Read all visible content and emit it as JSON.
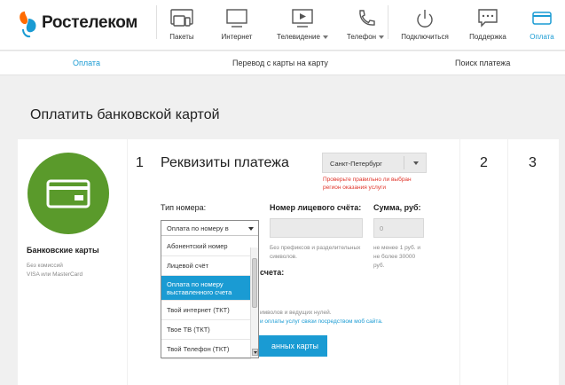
{
  "brand": {
    "name": "Ростелеком",
    "accent": "#1a9bd3",
    "orange": "#ff6b00"
  },
  "nav": {
    "items": [
      {
        "label": "Пакеты",
        "icon": "packages-icon"
      },
      {
        "label": "Интернет",
        "icon": "monitor-icon"
      },
      {
        "label": "Телевидение",
        "icon": "tv-icon"
      },
      {
        "label": "Телефон",
        "icon": "phone-icon"
      },
      {
        "label": "Подключиться",
        "icon": "power-icon"
      },
      {
        "label": "Поддержка",
        "icon": "chat-icon"
      },
      {
        "label": "Оплата",
        "icon": "card-icon"
      }
    ]
  },
  "subnav": {
    "payment": "Оплата",
    "card_transfer": "Перевод с карты на карту",
    "payment_search": "Поиск платежа"
  },
  "page": {
    "title": "Оплатить банковской картой"
  },
  "sidebar": {
    "title": "Банковские карты",
    "subtitle": "Без комиссий\nVISA или MasterCard",
    "icon": "bank-card-icon",
    "circle_color": "#5a9a2b"
  },
  "step1": {
    "number": "1",
    "title": "Реквизиты платежа",
    "region": "Санкт-Петербург",
    "region_warning": "Проверьте правильно ли выбран регион оказания услуги",
    "type_label": "Тип номера:",
    "type_value": "Оплата по номеру в",
    "account_label": "Номер лицевого счёта:",
    "account_hint": "Без префиксов и разделительных символов.",
    "sum_label": "Сумма, руб:",
    "sum_placeholder": "0",
    "sum_hint": "не менее 1 руб. и не более 30000 руб.",
    "partial_label": "счета:",
    "partial_hint_1": "имволов и ведущих нулей.",
    "partial_hint_2": "и оплаты услуг связи посредством моб сайта.",
    "submit": "анных карты"
  },
  "dropdown": {
    "options": [
      "Абонентский номер",
      "Лицевой счёт",
      "Оплата по номеру выставленного счета",
      "Твой интернет (ТКТ)",
      "Твое ТВ (ТКТ)",
      "Твой Телефон (ТКТ)"
    ],
    "selected_index": 2
  },
  "steps": {
    "two": "2",
    "three": "3"
  }
}
